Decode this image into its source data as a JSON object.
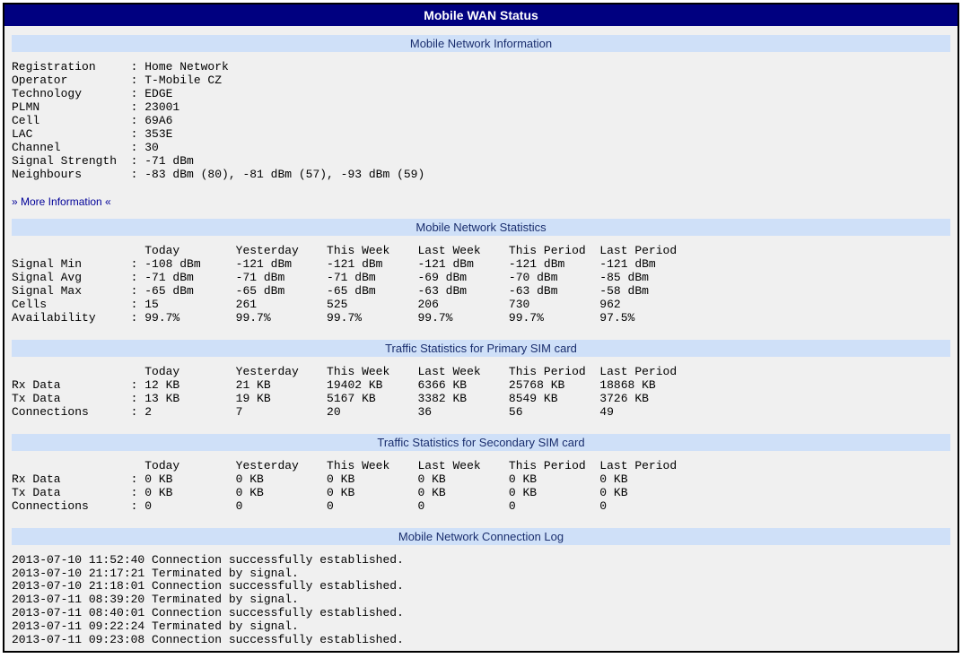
{
  "page_title": "Mobile WAN Status",
  "sections": {
    "network_info": {
      "header": "Mobile Network Information",
      "rows": [
        {
          "label": "Registration",
          "value": "Home Network"
        },
        {
          "label": "Operator",
          "value": "T-Mobile CZ"
        },
        {
          "label": "Technology",
          "value": "EDGE"
        },
        {
          "label": "PLMN",
          "value": "23001"
        },
        {
          "label": "Cell",
          "value": "69A6"
        },
        {
          "label": "LAC",
          "value": "353E"
        },
        {
          "label": "Channel",
          "value": "30"
        },
        {
          "label": "Signal Strength",
          "value": "-71 dBm"
        },
        {
          "label": "Neighbours",
          "value": "-83 dBm (80), -81 dBm (57), -93 dBm (59)"
        }
      ],
      "more_link": "» More Information «"
    },
    "network_stats": {
      "header": "Mobile Network Statistics",
      "columns": [
        "Today",
        "Yesterday",
        "This Week",
        "Last Week",
        "This Period",
        "Last Period"
      ],
      "metrics": [
        {
          "label": "Signal Min",
          "values": [
            "-108 dBm",
            "-121 dBm",
            "-121 dBm",
            "-121 dBm",
            "-121 dBm",
            "-121 dBm"
          ]
        },
        {
          "label": "Signal Avg",
          "values": [
            "-71 dBm",
            "-71 dBm",
            "-71 dBm",
            "-69 dBm",
            "-70 dBm",
            "-85 dBm"
          ]
        },
        {
          "label": "Signal Max",
          "values": [
            "-65 dBm",
            "-65 dBm",
            "-65 dBm",
            "-63 dBm",
            "-63 dBm",
            "-58 dBm"
          ]
        },
        {
          "label": "Cells",
          "values": [
            "15",
            "261",
            "525",
            "206",
            "730",
            "962"
          ]
        },
        {
          "label": "Availability",
          "values": [
            "99.7%",
            "99.7%",
            "99.7%",
            "99.7%",
            "99.7%",
            "97.5%"
          ]
        }
      ]
    },
    "primary_sim": {
      "header": "Traffic Statistics for Primary SIM card",
      "columns": [
        "Today",
        "Yesterday",
        "This Week",
        "Last Week",
        "This Period",
        "Last Period"
      ],
      "metrics": [
        {
          "label": "Rx Data",
          "values": [
            "12 KB",
            "21 KB",
            "19402 KB",
            "6366 KB",
            "25768 KB",
            "18868 KB"
          ]
        },
        {
          "label": "Tx Data",
          "values": [
            "13 KB",
            "19 KB",
            "5167 KB",
            "3382 KB",
            "8549 KB",
            "3726 KB"
          ]
        },
        {
          "label": "Connections",
          "values": [
            "2",
            "7",
            "20",
            "36",
            "56",
            "49"
          ]
        }
      ]
    },
    "secondary_sim": {
      "header": "Traffic Statistics for Secondary SIM card",
      "columns": [
        "Today",
        "Yesterday",
        "This Week",
        "Last Week",
        "This Period",
        "Last Period"
      ],
      "metrics": [
        {
          "label": "Rx Data",
          "values": [
            "0 KB",
            "0 KB",
            "0 KB",
            "0 KB",
            "0 KB",
            "0 KB"
          ]
        },
        {
          "label": "Tx Data",
          "values": [
            "0 KB",
            "0 KB",
            "0 KB",
            "0 KB",
            "0 KB",
            "0 KB"
          ]
        },
        {
          "label": "Connections",
          "values": [
            "0",
            "0",
            "0",
            "0",
            "0",
            "0"
          ]
        }
      ]
    },
    "connection_log": {
      "header": "Mobile Network Connection Log",
      "entries": [
        "2013-07-10 11:52:40 Connection successfully established.",
        "2013-07-10 21:17:21 Terminated by signal.",
        "2013-07-10 21:18:01 Connection successfully established.",
        "2013-07-11 08:39:20 Terminated by signal.",
        "2013-07-11 08:40:01 Connection successfully established.",
        "2013-07-11 09:22:24 Terminated by signal.",
        "2013-07-11 09:23:08 Connection successfully established."
      ]
    }
  }
}
